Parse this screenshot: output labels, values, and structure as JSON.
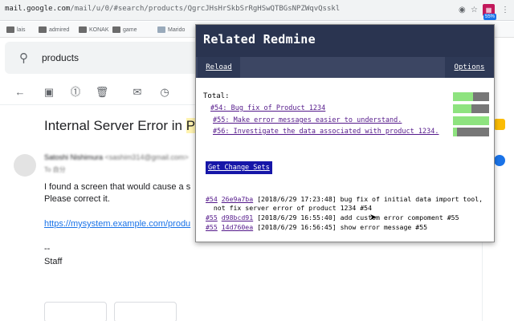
{
  "browser": {
    "url_host": "mail.google.com",
    "url_path": "/mail/u/0/#search/products/QgrcJHsHrSkbSrRgHSwQTBGsNPZWqvQsskl",
    "extension_badge": "55%",
    "bookmarks": [
      "lais",
      "admired",
      "KONAK",
      "game",
      "Marido"
    ]
  },
  "gmail": {
    "search_value": "products",
    "subject_prefix": "Internal Server Error in ",
    "subject_highlight": "Pr",
    "sender_name": "Satoshi Nishimura",
    "sender_email": "<sashim314@gmail.com>",
    "to_line": "To 自分",
    "body_line1": "I found a screen that would cause a s",
    "body_line2": "Please correct it.",
    "body_link": "https://mysystem.example.com/produ",
    "signature_dash": "--",
    "signature_name": "Staff"
  },
  "popup": {
    "title": "Related Redmine",
    "reload_label": "Reload",
    "options_label": "Options",
    "total_label": "Total:",
    "issues": [
      {
        "text": "#54: Bug fix of Product 1234",
        "progress": 0.5
      },
      {
        "text": "#55: Make error messages easier to understand.",
        "progress": 1.0
      },
      {
        "text": "#56: Investigate the data associated with product 1234.",
        "progress": 0.1
      }
    ],
    "total_progress": 0.55,
    "get_changesets_label": "Get Change Sets",
    "commits": [
      {
        "issue": "#54",
        "hash": "26e9a7ba",
        "rest": " [2018/6/29 17:23:48] bug fix of initial data import tool,",
        "rest2": "  not fix server error of product 1234 #54"
      },
      {
        "issue": "#55",
        "hash": "d98bcd91",
        "rest": " [2018/6/29 16:55:40] add custom error compoment #55",
        "rest2": ""
      },
      {
        "issue": "#55",
        "hash": "14d760ea",
        "rest": " [2018/6/29 16:56:45] show error message #55",
        "rest2": ""
      }
    ]
  },
  "colors": {
    "popup_header": "#2a3450",
    "popup_nav": "#3c4663",
    "progress_done": "#8ee37f",
    "progress_todo": "#777777",
    "changeset_button": "#1616a8",
    "link_visited": "#551a8b"
  }
}
